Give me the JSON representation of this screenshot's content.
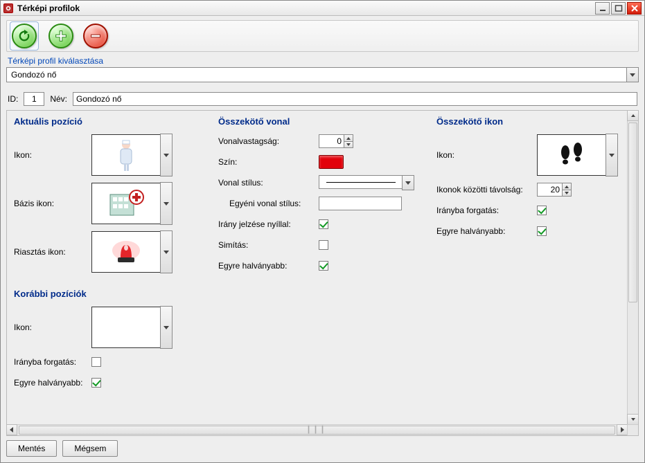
{
  "window": {
    "title": "Térképi profilok"
  },
  "toolbar": {
    "refresh_icon": "refresh-icon",
    "add_icon": "add-icon",
    "remove_icon": "remove-icon"
  },
  "selector": {
    "label": "Térképi profil kiválasztása",
    "value": "Gondozó nő"
  },
  "identity": {
    "id_label": "ID:",
    "id_value": "1",
    "name_label": "Név:",
    "name_value": "Gondozó nő"
  },
  "sections": {
    "current": {
      "title": "Aktuális pozíció",
      "icon_label": "Ikon:",
      "base_icon_label": "Bázis ikon:",
      "alarm_icon_label": "Riasztás ikon:",
      "icon": "nurse-icon",
      "base_icon": "hospital-icon",
      "alarm_icon": "siren-icon"
    },
    "previous": {
      "title": "Korábbi pozíciók",
      "icon_label": "Ikon:",
      "rotate_label": "Irányba forgatás:",
      "rotate_checked": false,
      "fade_label": "Egyre halványabb:",
      "fade_checked": true
    },
    "line": {
      "title": "Összekötő vonal",
      "thickness_label": "Vonalvastagság:",
      "thickness_value": "0",
      "color_label": "Szín:",
      "color_value": "#e2020b",
      "style_label": "Vonal stílus:",
      "custom_style_label": "Egyéni vonal stílus:",
      "custom_style_value": "",
      "arrow_label": "Irány jelzése nyíllal:",
      "arrow_checked": true,
      "smooth_label": "Simítás:",
      "smooth_checked": false,
      "fade_label": "Egyre halványabb:",
      "fade_checked": true
    },
    "conn_icon": {
      "title": "Összekötő ikon",
      "icon_label": "Ikon:",
      "icon": "footprints-icon",
      "distance_label": "Ikonok közötti távolság:",
      "distance_value": "20",
      "rotate_label": "Irányba forgatás:",
      "rotate_checked": true,
      "fade_label": "Egyre halványabb:",
      "fade_checked": true
    }
  },
  "footer": {
    "save_label": "Mentés",
    "cancel_label": "Mégsem"
  }
}
